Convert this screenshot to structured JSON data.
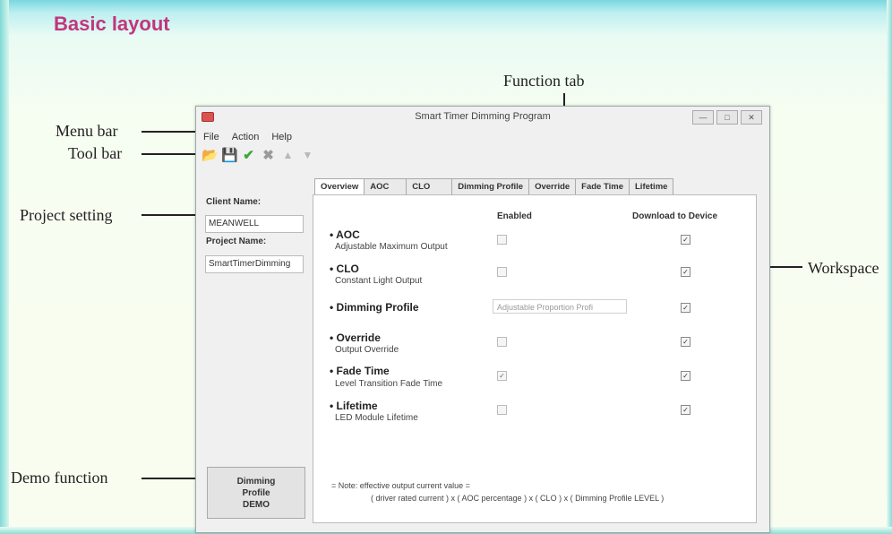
{
  "heading": "Basic layout",
  "callouts": {
    "function_tab": "Function tab",
    "menu_bar": "Menu bar",
    "tool_bar": "Tool bar",
    "project_setting": "Project setting",
    "workspace": "Workspace",
    "demo_function": "Demo function"
  },
  "window": {
    "title": "Smart Timer Dimming Program",
    "controls": [
      "—",
      "□",
      "✕"
    ]
  },
  "menu": [
    "File",
    "Action",
    "Help"
  ],
  "toolbar": {
    "icons": [
      "open-file-icon",
      "save-icon",
      "check-icon",
      "cancel-icon",
      "upload-icon",
      "download-icon"
    ]
  },
  "project": {
    "client_label": "Client Name:",
    "client_value": "MEANWELL",
    "project_label": "Project Name:",
    "project_value": "SmartTimerDimming"
  },
  "demo_button": [
    "Dimming",
    "Profile",
    "DEMO"
  ],
  "tabs": [
    "Overview",
    "AOC",
    "CLO",
    "Dimming Profile",
    "Override",
    "Fade Time",
    "Lifetime"
  ],
  "active_tab": "Overview",
  "columns": {
    "enabled": "Enabled",
    "download": "Download to Device"
  },
  "features": [
    {
      "title": "• AOC",
      "subtitle": "Adjustable Maximum Output",
      "enabled": false,
      "download": true
    },
    {
      "title": "• CLO",
      "subtitle": "Constant Light Output",
      "enabled": false,
      "download": true
    },
    {
      "title": "• Dimming Profile",
      "subtitle": "",
      "select_value": "Adjustable Proportion Profi",
      "download": true
    },
    {
      "title": "• Override",
      "subtitle": "Output Override",
      "enabled": false,
      "download": true
    },
    {
      "title": "• Fade Time",
      "subtitle": "Level Transition Fade Time",
      "enabled": true,
      "download": true
    },
    {
      "title": "• Lifetime",
      "subtitle": "LED Module Lifetime",
      "enabled": false,
      "download": true
    }
  ],
  "note": {
    "line1": "= Note: effective output current value =",
    "line2": "( driver rated current ) x ( AOC percentage ) x ( CLO ) x ( Dimming Profile LEVEL )"
  },
  "check_glyph": "✓"
}
